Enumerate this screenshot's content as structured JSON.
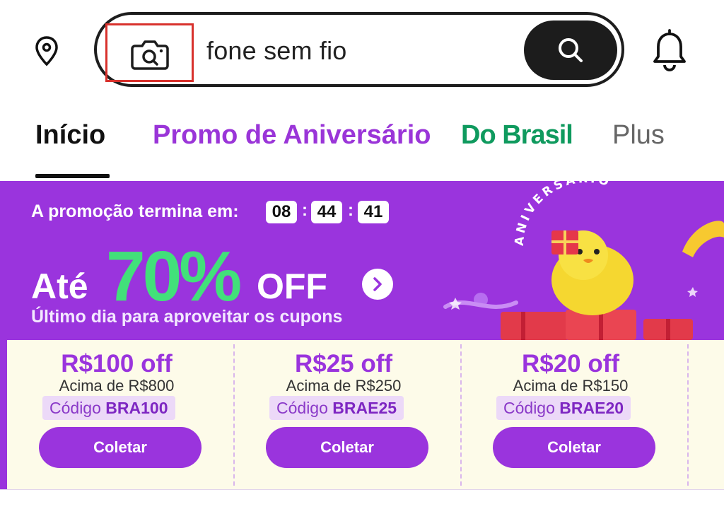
{
  "header": {
    "search_value": "fone sem fio",
    "icons": [
      "location-pin-icon",
      "camera-icon",
      "search-icon",
      "bell-icon"
    ]
  },
  "tabs": [
    {
      "label": "Início",
      "active": true,
      "color": "#111111"
    },
    {
      "label": "Promo de Aniversário",
      "color": "#9a35d8"
    },
    {
      "label": "Do Brasil",
      "color": "#0f9a5e"
    },
    {
      "label": "Plus",
      "color": "#666666"
    }
  ],
  "banner": {
    "ends_label": "A promoção termina em:",
    "timer": {
      "hours": "08",
      "minutes": "44",
      "seconds": "41",
      "separator": ":"
    },
    "prefix": "Até",
    "percent": "70%",
    "suffix": "OFF",
    "subline": "Último dia para aproveitar os cupons",
    "art_text": "ANIVERSÁRIO",
    "bg_color": "#9a34dd",
    "accent_color": "#42e07a"
  },
  "coupons": [
    {
      "amount": "R$100 off",
      "min": "Acima de R$800",
      "code_label": "Código",
      "code": "BRA100",
      "button": "Coletar"
    },
    {
      "amount": "R$25 off",
      "min": "Acima de R$250",
      "code_label": "Código",
      "code": "BRAE25",
      "button": "Coletar"
    },
    {
      "amount": "R$20 off",
      "min": "Acima de R$150",
      "code_label": "Código",
      "code": "BRAE20",
      "button": "Coletar"
    }
  ]
}
